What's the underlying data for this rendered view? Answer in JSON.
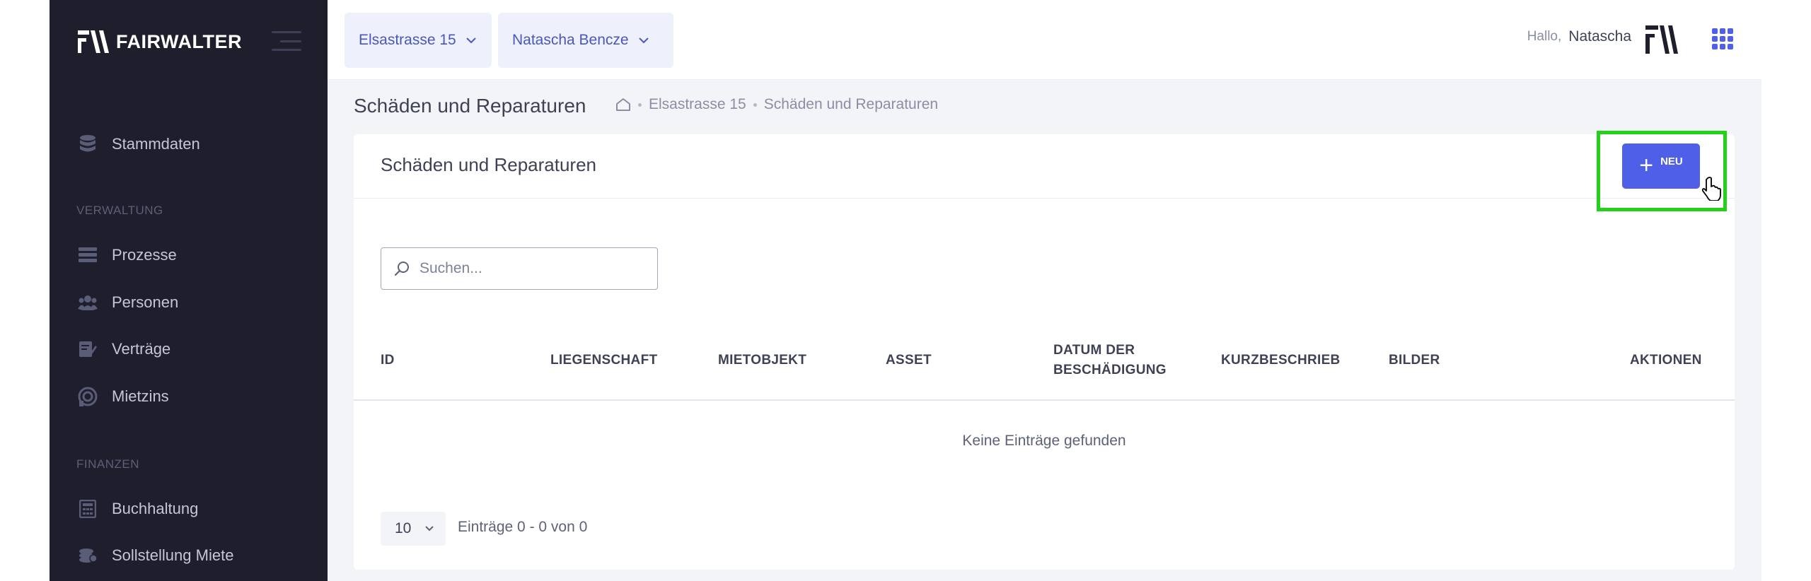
{
  "sidebar": {
    "brand": "FAIRWALTER",
    "items": [
      {
        "label": "Stammdaten",
        "icon": "database-icon"
      },
      {
        "label": "Prozesse",
        "icon": "list-icon"
      },
      {
        "label": "Personen",
        "icon": "users-icon"
      },
      {
        "label": "Verträge",
        "icon": "contract-icon"
      },
      {
        "label": "Mietzins",
        "icon": "rent-icon"
      },
      {
        "label": "Buchhaltung",
        "icon": "calculator-icon"
      },
      {
        "label": "Sollstellung Miete",
        "icon": "coins-icon"
      }
    ],
    "sections": {
      "verwaltung": "VERWALTUNG",
      "finanzen": "FINANZEN"
    }
  },
  "header": {
    "property_select": "Elsastrasse 15",
    "user_select": "Natascha Bencze",
    "greeting": "Hallo,",
    "user_name": "Natascha"
  },
  "page": {
    "title": "Schäden und Reparaturen",
    "breadcrumb": [
      "Elsastrasse 15",
      "Schäden und Reparaturen"
    ]
  },
  "card": {
    "title": "Schäden und Reparaturen",
    "new_button": "NEU",
    "search_placeholder": "Suchen...",
    "columns": [
      "ID",
      "LIEGENSCHAFT",
      "MIETOBJEKT",
      "ASSET",
      "DATUM DER",
      "BESCHÄDIGUNG",
      "KURZBESCHRIEB",
      "BILDER",
      "AKTIONEN"
    ],
    "empty_message": "Keine Einträge gefunden",
    "page_size": "10",
    "entries_info": "Einträge 0 - 0 von 0"
  },
  "colors": {
    "sidebar_bg": "#1e1e2d",
    "accent": "#4f5fe8",
    "highlight": "#22d11a",
    "page_bg": "#f3f4f8"
  }
}
